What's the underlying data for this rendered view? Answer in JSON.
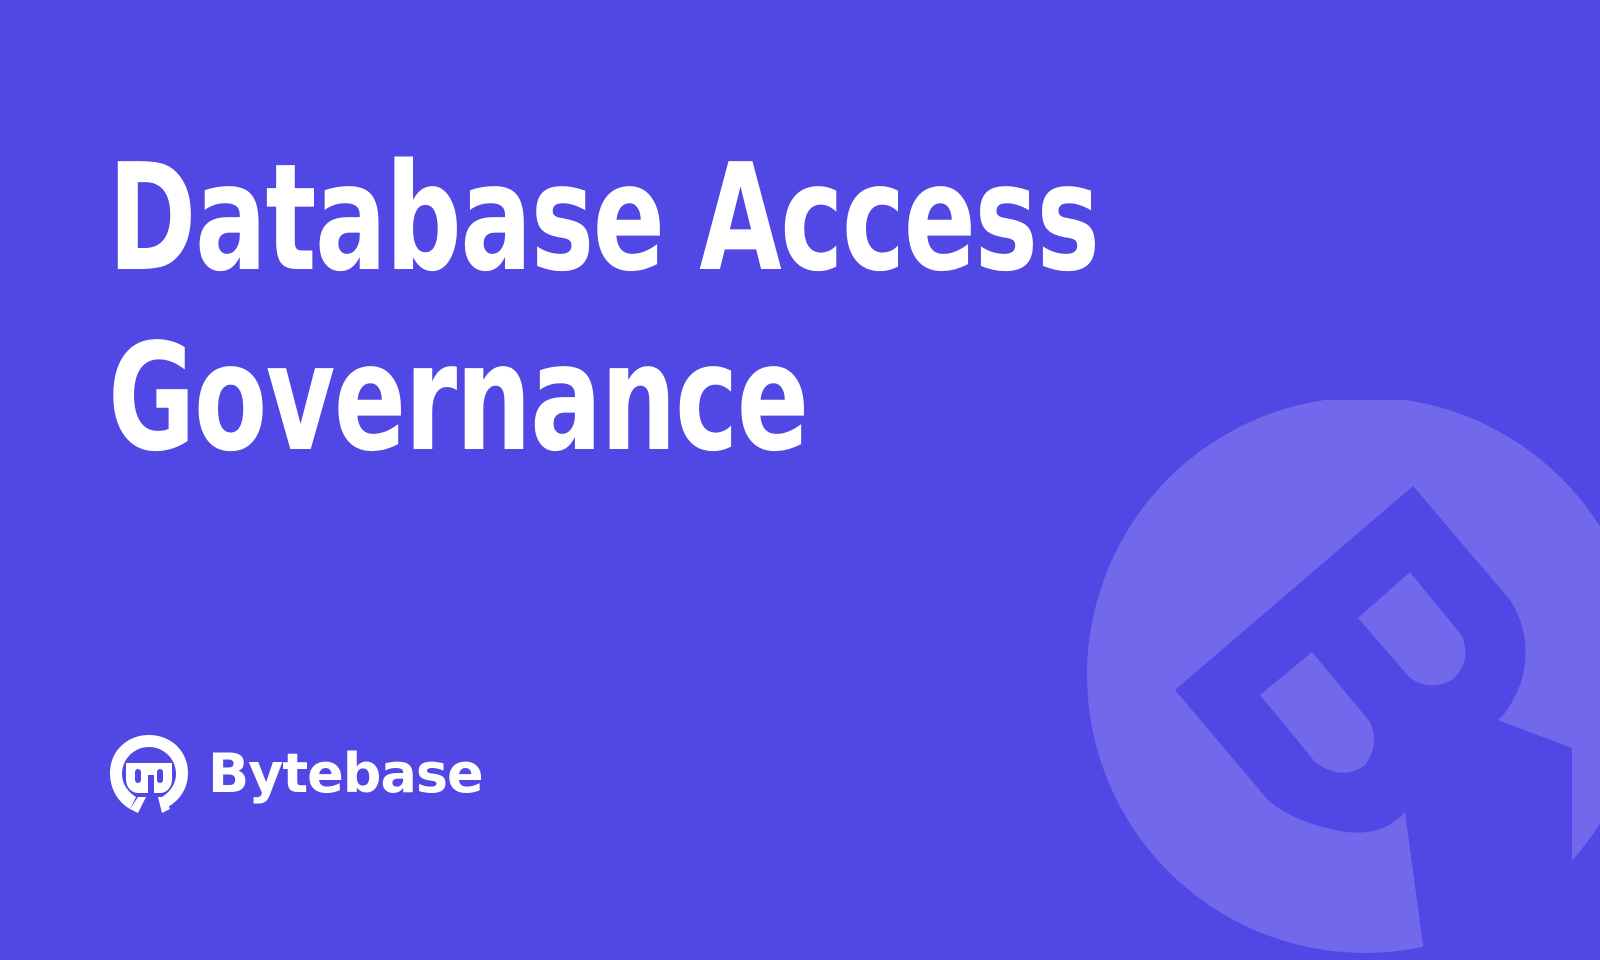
{
  "colors": {
    "background": "#5047e5",
    "text": "#ffffff",
    "mark": "#7168ec"
  },
  "hero": {
    "title_line1": "Database Access",
    "title_line2": "Governance"
  },
  "brand": {
    "name": "Bytebase",
    "logo_icon": "bytebase-logo-icon",
    "watermark_icon": "bytebase-watermark-icon"
  }
}
